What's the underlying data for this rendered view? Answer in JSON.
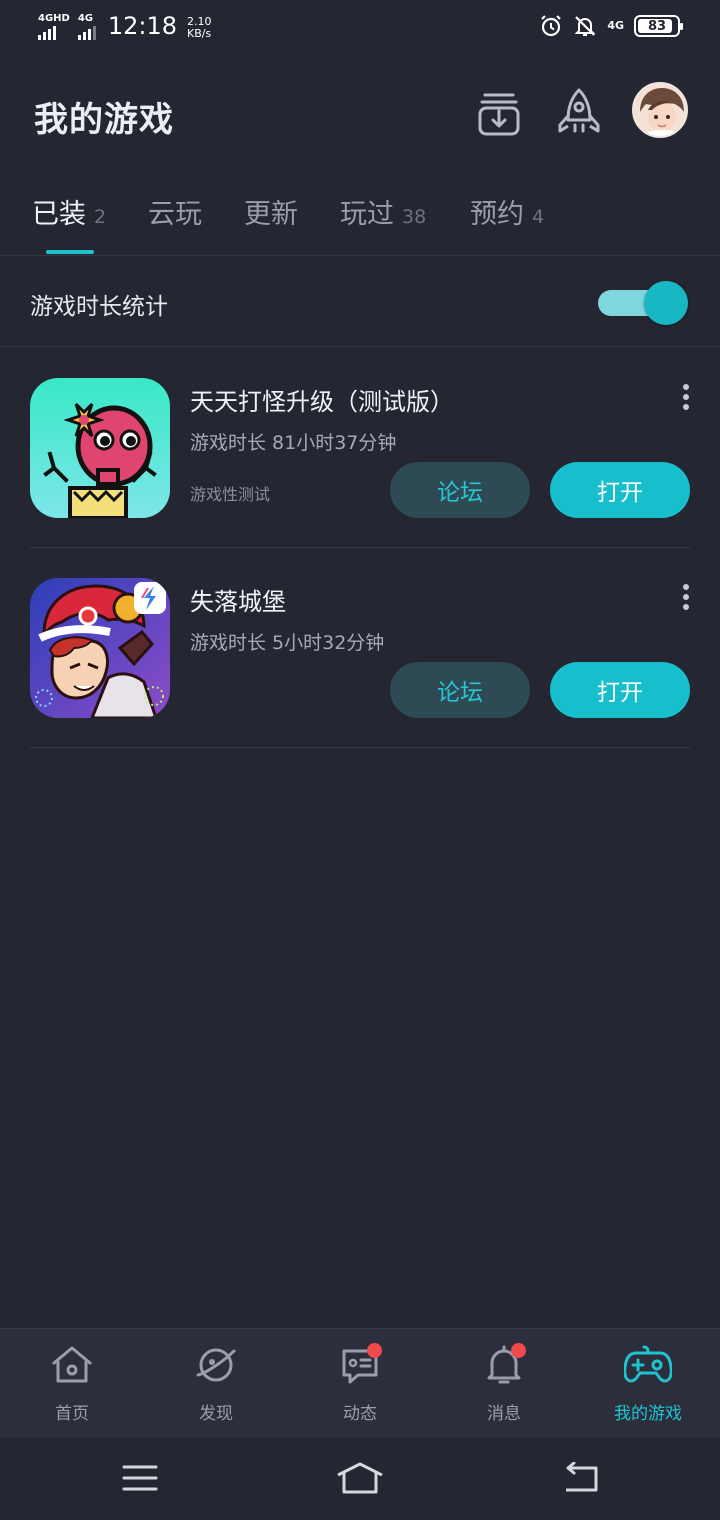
{
  "status_bar": {
    "signal1_label": "4GHD",
    "signal2_label": "4G",
    "time": "12:18",
    "rate_value": "2.10",
    "rate_unit": "KB/s",
    "net_label": "4G",
    "battery": "83"
  },
  "header": {
    "title": "我的游戏"
  },
  "tabs": [
    {
      "label": "已装",
      "count": "2"
    },
    {
      "label": "云玩",
      "count": ""
    },
    {
      "label": "更新",
      "count": ""
    },
    {
      "label": "玩过",
      "count": "38"
    },
    {
      "label": "预约",
      "count": "4"
    }
  ],
  "stats": {
    "label": "游戏时长统计",
    "enabled": true
  },
  "games": [
    {
      "name": "天天打怪升级（测试版）",
      "playtime": "游戏时长 81小时37分钟",
      "tag": "游戏性测试",
      "forum_label": "论坛",
      "open_label": "打开"
    },
    {
      "name": "失落城堡",
      "playtime": "游戏时长 5小时32分钟",
      "tag": "",
      "forum_label": "论坛",
      "open_label": "打开"
    }
  ],
  "bottom_nav": [
    {
      "label": "首页",
      "icon": "home-icon"
    },
    {
      "label": "发现",
      "icon": "planet-icon"
    },
    {
      "label": "动态",
      "icon": "chat-icon",
      "badge": true
    },
    {
      "label": "消息",
      "icon": "bell-icon",
      "badge": true
    },
    {
      "label": "我的游戏",
      "icon": "gamepad-icon",
      "active": true
    }
  ],
  "colors": {
    "background": "#242631",
    "accent": "#1ec3cf",
    "badge": "#f2494e"
  }
}
